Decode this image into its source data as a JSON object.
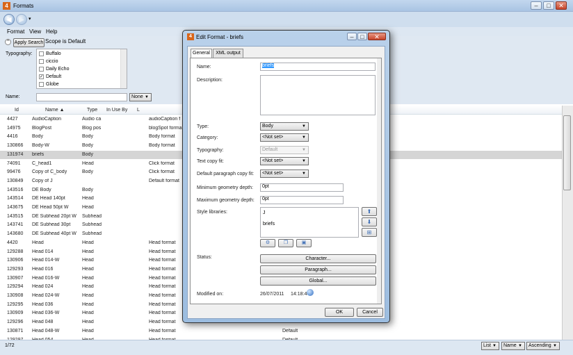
{
  "window": {
    "title": "Formats",
    "app_icon": "formats-app-icon",
    "minimize": "–",
    "maximize": "□",
    "close": "✕"
  },
  "nav": {
    "back": "back-arrow-icon",
    "forward": "forward-arrow-icon",
    "dropdown": "▾"
  },
  "menu": {
    "items": [
      "Format",
      "View",
      "Help"
    ]
  },
  "search": {
    "apply_label": "Apply Search",
    "scope_text": "Scope is Default",
    "typography_label": "Typography:",
    "typography_items": [
      {
        "label": "Buffalo",
        "checked": false
      },
      {
        "label": "ciccio",
        "checked": false
      },
      {
        "label": "Daily Echo",
        "checked": false
      },
      {
        "label": "Default",
        "checked": true
      },
      {
        "label": "Globe",
        "checked": false
      }
    ],
    "name_label": "Name:",
    "name_value": "",
    "name_mode": "None"
  },
  "grid": {
    "columns": [
      "Id",
      "Name",
      "Type",
      "In Use By",
      "L"
    ],
    "sort_indicator": "▲",
    "rows": [
      [
        "4427",
        "AudioCaption",
        "Audio ca",
        "",
        "",
        "audioCaption f",
        ""
      ],
      [
        "14975",
        "BlogPost",
        "Blog pos",
        "",
        "",
        "blogSpot forma",
        ""
      ],
      [
        "4416",
        "Body",
        "Body",
        "",
        "",
        "Body format",
        ""
      ],
      [
        "130866",
        "Body-W",
        "Body",
        "",
        "",
        "Body format",
        ""
      ],
      [
        "131974",
        "briefs",
        "Body",
        "",
        "",
        "",
        ""
      ],
      [
        "74091",
        "C_head1",
        "Head",
        "",
        "",
        "Click format",
        ""
      ],
      [
        "99476",
        "Copy of C_body",
        "Body",
        "",
        "",
        "Click format",
        ""
      ],
      [
        "130849",
        "Copy of J",
        "",
        "",
        "",
        "Default format",
        ""
      ],
      [
        "143516",
        "DE Body",
        "Body",
        "",
        "",
        "",
        ""
      ],
      [
        "143514",
        "DE Head 140pt",
        "Head",
        "",
        "",
        "",
        ""
      ],
      [
        "143675",
        "DE Head 50pt W",
        "Head",
        "",
        "",
        "",
        ""
      ],
      [
        "143515",
        "DE Subhead 20pt W",
        "Subhead",
        "",
        "",
        "",
        ""
      ],
      [
        "143741",
        "DE Subhead 30pt",
        "Subhead",
        "",
        "",
        "",
        ""
      ],
      [
        "143680",
        "DE Subhead 40pt W",
        "Subhead",
        "",
        "",
        "",
        ""
      ],
      [
        "4420",
        "Head",
        "Head",
        "",
        "",
        "Head format",
        ""
      ],
      [
        "129288",
        "Head 014",
        "Head",
        "",
        "",
        "Head format",
        ""
      ],
      [
        "130906",
        "Head 014-W",
        "Head",
        "",
        "",
        "Head format",
        ""
      ],
      [
        "129293",
        "Head 016",
        "Head",
        "",
        "",
        "Head format",
        ""
      ],
      [
        "130907",
        "Head 016-W",
        "Head",
        "",
        "",
        "Head format",
        ""
      ],
      [
        "129294",
        "Head 024",
        "Head",
        "",
        "",
        "Head format",
        ""
      ],
      [
        "130908",
        "Head 024-W",
        "Head",
        "",
        "",
        "Head format",
        ""
      ],
      [
        "129295",
        "Head 036",
        "Head",
        "",
        "",
        "Head format",
        ""
      ],
      [
        "130909",
        "Head 036-W",
        "Head",
        "",
        "",
        "Head format",
        ""
      ],
      [
        "129296",
        "Head 048",
        "Head",
        "",
        "",
        "Head format",
        ""
      ],
      [
        "130871",
        "Head 048-W",
        "Head",
        "",
        "",
        "Head format",
        "Default"
      ],
      [
        "129297",
        "Head 054",
        "Head",
        "",
        "",
        "Head format",
        "Default"
      ]
    ],
    "selected_index": 4
  },
  "status": {
    "count": "1/72",
    "view": "List",
    "sort_by": "Name",
    "order": "Ascending"
  },
  "dialog": {
    "title": "Edit Format - briefs",
    "tabs": [
      "General",
      "XML output"
    ],
    "name_label": "Name:",
    "name_value": "briefs",
    "description_label": "Description:",
    "description_value": "",
    "type_label": "Type:",
    "type_value": "Body",
    "category_label": "Category:",
    "category_value": "<Not set>",
    "typography_label": "Typography:",
    "typography_value": "Default",
    "text_copy_fit_label": "Text copy fit:",
    "text_copy_fit_value": "<Not set>",
    "para_copy_fit_label": "Default paragraph copy fit:",
    "para_copy_fit_value": "<Not set>",
    "min_geo_label": "Minimum geometry depth:",
    "min_geo_value": "0pt",
    "max_geo_label": "Maximum geometry depth:",
    "max_geo_value": "0pt",
    "style_libraries_label": "Style libraries:",
    "style_libraries": [
      "J",
      "briefs"
    ],
    "status_label": "Status:",
    "character_btn": "Character...",
    "paragraph_btn": "Paragraph...",
    "global_btn": "Global...",
    "modified_label": "Modified on:",
    "modified_date": "26/07/2011",
    "modified_time": "14:18:44",
    "ok": "OK",
    "cancel": "Cancel",
    "close": "✕",
    "minimize": "–",
    "maximize": "□"
  }
}
